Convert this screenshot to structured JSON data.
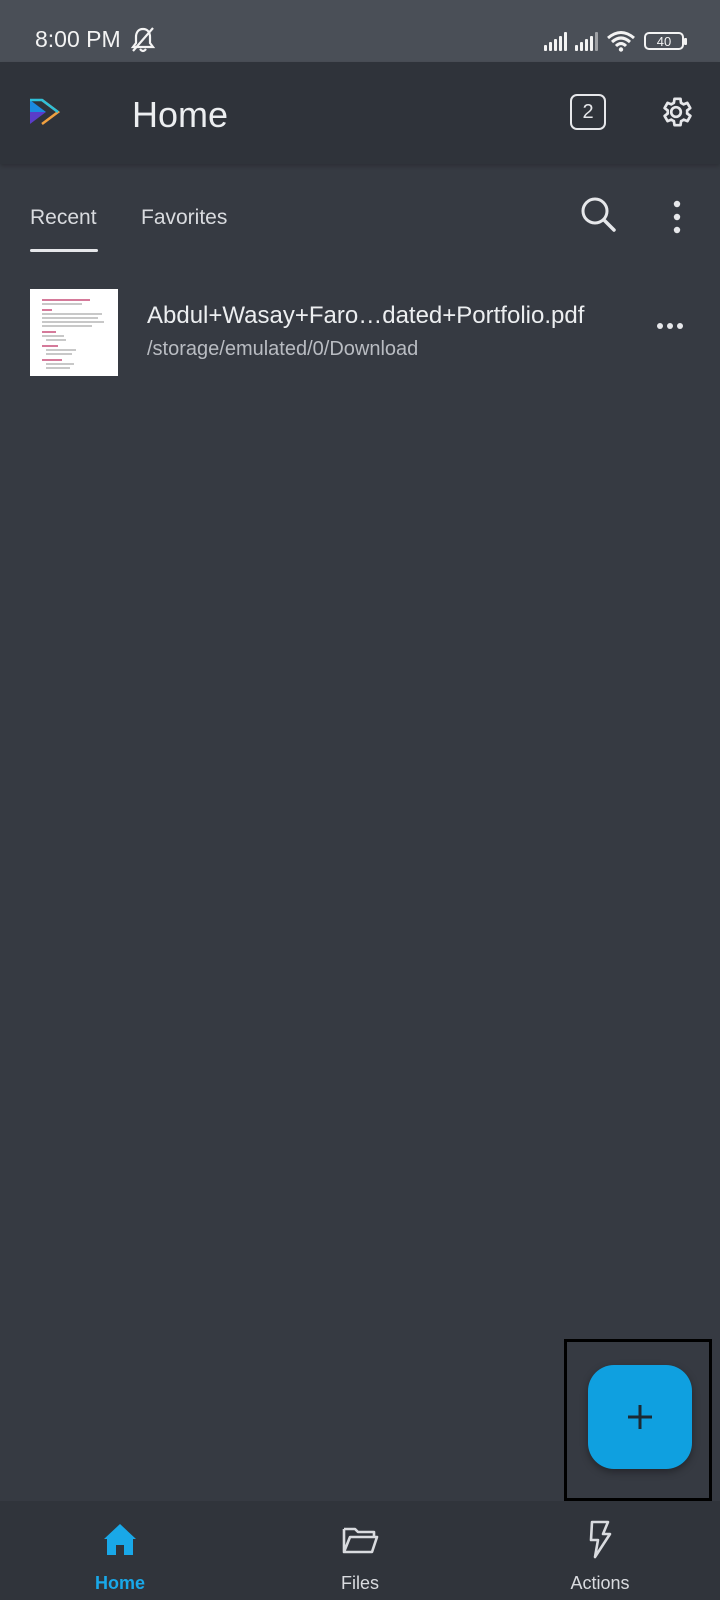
{
  "status_bar": {
    "time": "8:00 PM",
    "battery": "40"
  },
  "app_bar": {
    "title": "Home",
    "tabs_count": "2"
  },
  "tabs": [
    {
      "label": "Recent",
      "active": true
    },
    {
      "label": "Favorites",
      "active": false
    }
  ],
  "recent_files": [
    {
      "name": "Abdul+Wasay+Faro…dated+Portfolio.pdf",
      "path": "/storage/emulated/0/Download"
    }
  ],
  "bottom_nav": [
    {
      "label": "Home",
      "icon": "home-icon",
      "active": true
    },
    {
      "label": "Files",
      "icon": "folder-open-icon",
      "active": false
    },
    {
      "label": "Actions",
      "icon": "lightning-icon",
      "active": false
    }
  ],
  "colors": {
    "accent": "#0fa0e0",
    "background": "#363a42",
    "app_bar": "#2f333a"
  }
}
